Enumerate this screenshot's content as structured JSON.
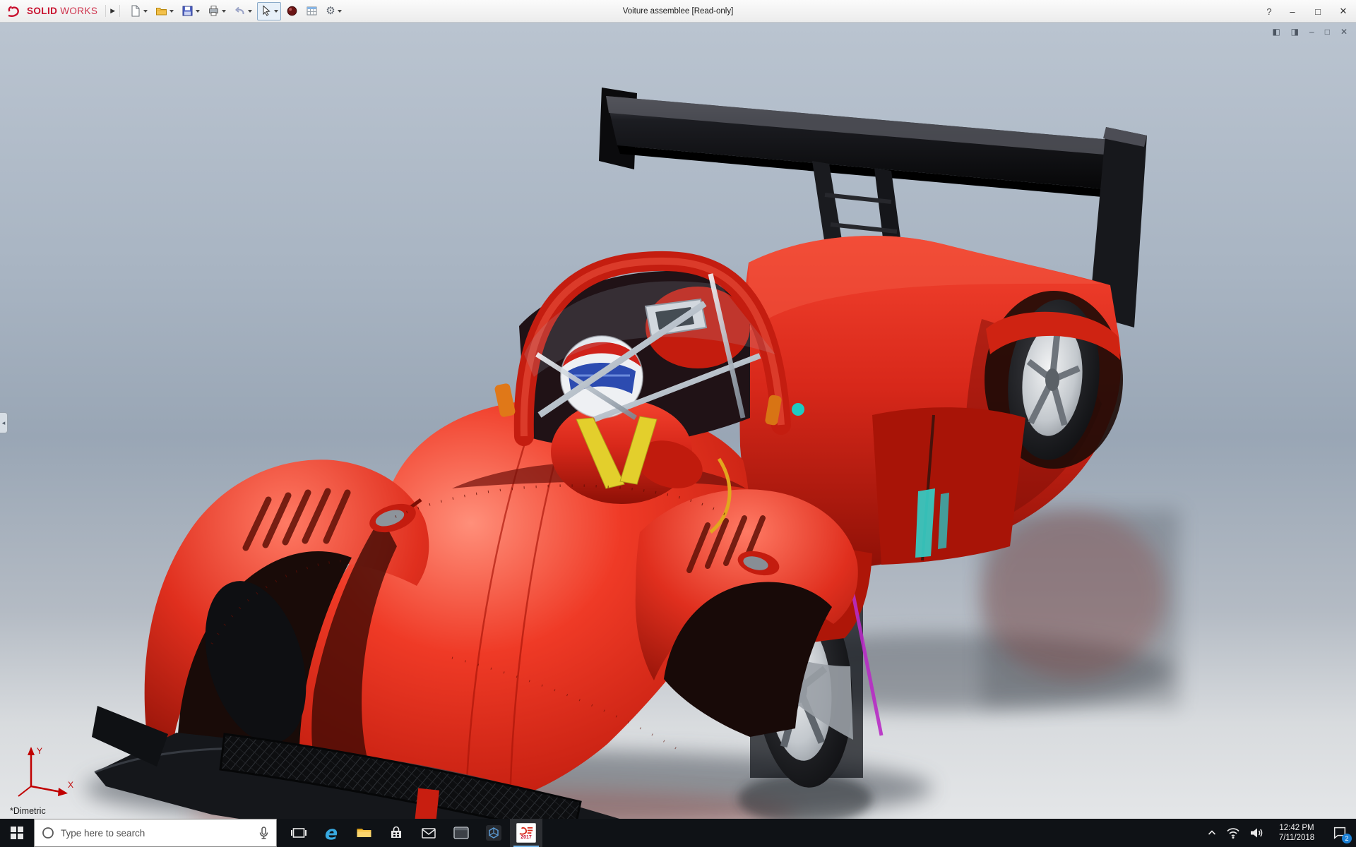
{
  "colors": {
    "car_body_red": "#d8281a",
    "car_body_highlight": "#ff8f7a",
    "car_body_shadow": "#8e1006",
    "wing_black": "#111114",
    "chrome": "#dfe4e9",
    "brand_red": "#c8102e",
    "viewport_top": "#bac4d0",
    "viewport_bottom": "#e4e6e8",
    "taskbar_bg": "#0f1216",
    "running_indicator": "#76b9ed",
    "badge_blue": "#1a7fd4"
  },
  "titlebar": {
    "logo_solid": "SOLID",
    "logo_works": "WORKS",
    "expand_arrow": "▶",
    "title": "Voiture assemblee [Read-only]",
    "help_label": "?",
    "minimize_glyph": "–",
    "maximize_glyph": "□",
    "close_glyph": "✕"
  },
  "viewport": {
    "doc_controls": [
      "◧",
      "◨",
      "–",
      "□",
      "✕"
    ],
    "view_orientation_label": "*Dimetric",
    "triad_x_label": "X",
    "triad_y_label": "Y"
  },
  "taskbar": {
    "search_placeholder": "Type here to search",
    "edge_letter": "e",
    "solidworks_year": "2017",
    "tray_time": "12:42 PM",
    "tray_date": "7/11/2018",
    "notification_badge": "2"
  }
}
